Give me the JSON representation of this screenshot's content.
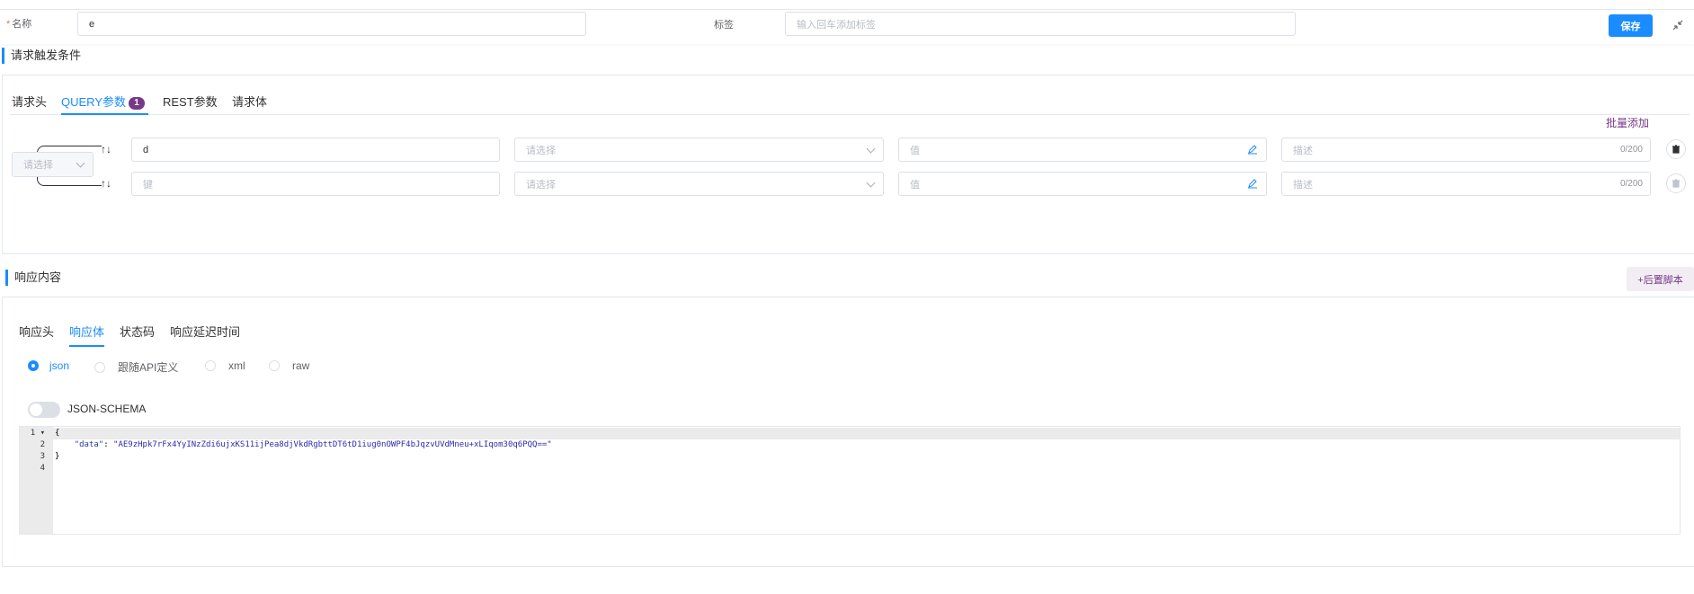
{
  "header": {
    "name_label": "名称",
    "name_required_mark": "*",
    "name_value": "e",
    "tag_label": "标签",
    "tag_placeholder": "输入回车添加标签",
    "save_label": "保存",
    "collapse_icon": "shrink-arrows-icon"
  },
  "request_conditions": {
    "title": "请求触发条件",
    "tabs": [
      {
        "label": "请求头",
        "active": false
      },
      {
        "label": "QUERY参数",
        "active": true,
        "badge": "1"
      },
      {
        "label": "REST参数",
        "active": false
      },
      {
        "label": "请求体",
        "active": false
      }
    ],
    "batch_add_label": "批量添加",
    "logic_select_placeholder": "请选择",
    "rows": [
      {
        "key": "d",
        "key_placeholder": "键",
        "condition_placeholder": "请选择",
        "value_placeholder": "值",
        "desc_placeholder": "描述",
        "counter": "0/200"
      },
      {
        "key": "",
        "key_placeholder": "键",
        "condition_placeholder": "请选择",
        "value_placeholder": "值",
        "desc_placeholder": "描述",
        "counter": "0/200"
      }
    ],
    "sort_arrows": "↑↓"
  },
  "response": {
    "title": "响应内容",
    "post_script_label": "+后置脚本",
    "tabs": [
      {
        "label": "响应头",
        "active": false
      },
      {
        "label": "响应体",
        "active": true
      },
      {
        "label": "状态码",
        "active": false
      },
      {
        "label": "响应延迟时间",
        "active": false
      }
    ],
    "body_types": [
      {
        "label": "json",
        "checked": true
      },
      {
        "label": "跟随API定义",
        "checked": false
      },
      {
        "label": "xml",
        "checked": false
      },
      {
        "label": "raw",
        "checked": false
      }
    ],
    "json_schema_label": "JSON-SCHEMA",
    "json_schema_enabled": false,
    "editor": {
      "line_numbers": [
        "1",
        "2",
        "3",
        "4"
      ],
      "lines": [
        {
          "text": "{"
        },
        {
          "indent": "    ",
          "key": "\"data\"",
          "sep": ": ",
          "value": "\"AE9zHpk7rFx4YyINzZdi6ujxKS11ijPea8djVkdRgbttDT6tD1iug0nOWPF4bJqzvUVdMneu+xLIqom30q6PQQ==\""
        },
        {
          "text": "}"
        },
        {
          "text": ""
        }
      ]
    }
  },
  "colors": {
    "primary": "#1a8cff",
    "accent_purple": "#783887",
    "border": "#dcdfe6"
  }
}
